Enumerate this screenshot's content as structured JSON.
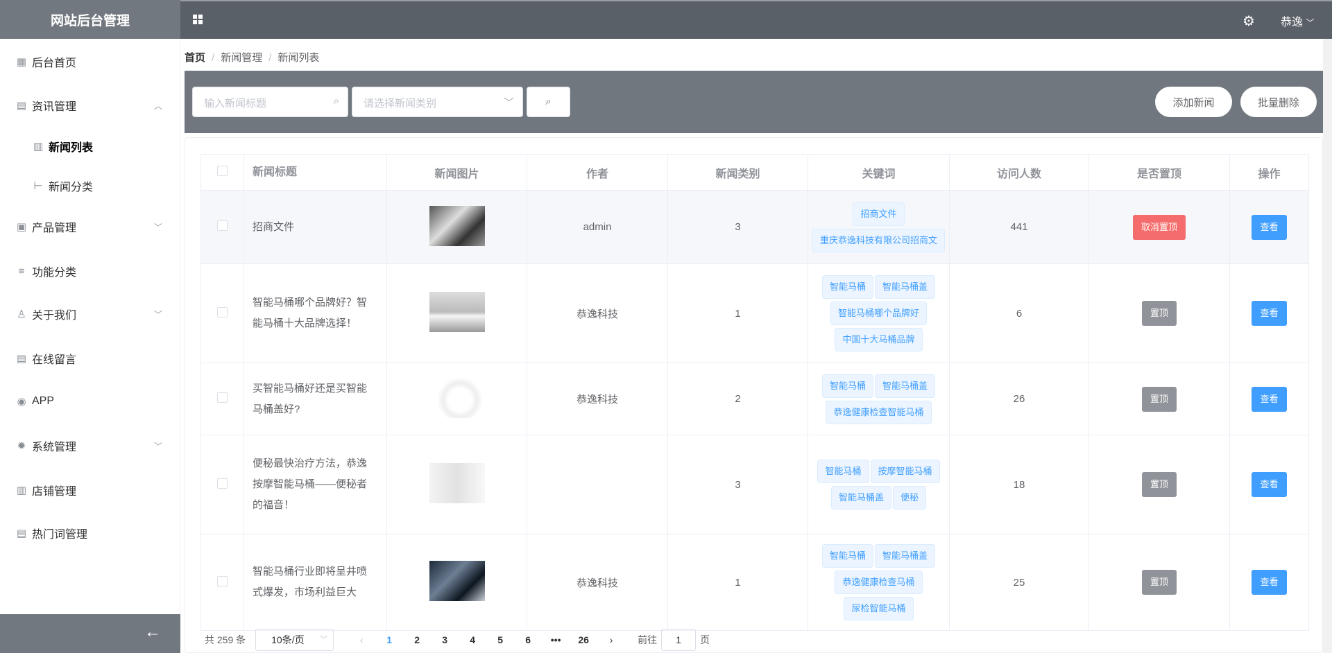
{
  "app": {
    "title": "网站后台管理",
    "user": "恭逸"
  },
  "sidebar": {
    "items": [
      {
        "label": "后台首页",
        "icon": "dashboard-icon"
      },
      {
        "label": "资讯管理",
        "icon": "news-icon",
        "expanded": true
      },
      {
        "label": "新闻列表",
        "icon": "list-icon",
        "active": true
      },
      {
        "label": "新闻分类",
        "icon": "tree-icon"
      },
      {
        "label": "产品管理",
        "icon": "box-icon"
      },
      {
        "label": "功能分类",
        "icon": "search-list-icon"
      },
      {
        "label": "关于我们",
        "icon": "user-icon"
      },
      {
        "label": "在线留言",
        "icon": "edit-icon"
      },
      {
        "label": "APP",
        "icon": "app-icon"
      },
      {
        "label": "系统管理",
        "icon": "gear-icon"
      },
      {
        "label": "店铺管理",
        "icon": "shop-icon"
      },
      {
        "label": "热门词管理",
        "icon": "edit-icon"
      }
    ]
  },
  "breadcrumb": [
    "首页",
    "新闻管理",
    "新闻列表"
  ],
  "toolbar": {
    "title_placeholder": "输入新闻标题",
    "category_placeholder": "请选择新闻类别",
    "add": "添加新闻",
    "batch_delete": "批量删除"
  },
  "table": {
    "headers": [
      "新闻标题",
      "新闻图片",
      "作者",
      "新闻类别",
      "关键词",
      "访问人数",
      "是否置顶",
      "操作"
    ],
    "rows": [
      {
        "title": "招商文件",
        "author": "admin",
        "category": "3",
        "keywords": [
          "招商文件",
          "重庆恭逸科技有限公司招商文"
        ],
        "visits": "441",
        "pin": "取消置顶",
        "pinned": true,
        "action": "查看"
      },
      {
        "title": "智能马桶哪个品牌好？智能马桶十大品牌选择！",
        "author": "恭逸科技",
        "category": "1",
        "keywords": [
          "智能马桶",
          "智能马桶盖",
          "智能马桶哪个品牌好",
          "中国十大马桶品牌"
        ],
        "visits": "6",
        "pin": "置顶",
        "pinned": false,
        "action": "查看"
      },
      {
        "title": "买智能马桶好还是买智能马桶盖好?",
        "author": "恭逸科技",
        "category": "2",
        "keywords": [
          "智能马桶",
          "智能马桶盖",
          "恭逸健康检查智能马桶"
        ],
        "visits": "26",
        "pin": "置顶",
        "pinned": false,
        "action": "查看"
      },
      {
        "title": "便秘最快治疗方法，恭逸按摩智能马桶——便秘者的福音！",
        "author": "",
        "category": "3",
        "keywords": [
          "智能马桶",
          "按摩智能马桶",
          "智能马桶盖",
          "便秘"
        ],
        "visits": "18",
        "pin": "置顶",
        "pinned": false,
        "action": "查看"
      },
      {
        "title": "智能马桶行业即将呈井喷式爆发，市场利益巨大",
        "author": "恭逸科技",
        "category": "1",
        "keywords": [
          "智能马桶",
          "智能马桶盖",
          "恭逸健康检查马桶",
          "尿检智能马桶"
        ],
        "visits": "25",
        "pin": "置顶",
        "pinned": false,
        "action": "查看"
      }
    ]
  },
  "pagination": {
    "total": "共 259 条",
    "page_size": "10条/页",
    "pages": [
      "1",
      "2",
      "3",
      "4",
      "5",
      "6",
      "•••",
      "26"
    ],
    "current": "1",
    "goto_label": "前往",
    "goto_value": "1",
    "page_suffix": "页"
  },
  "colors": {
    "primary": "#409eff",
    "danger": "#f56c6c",
    "info": "#909399",
    "header": "#5a6068",
    "toolbar": "#70777e"
  }
}
